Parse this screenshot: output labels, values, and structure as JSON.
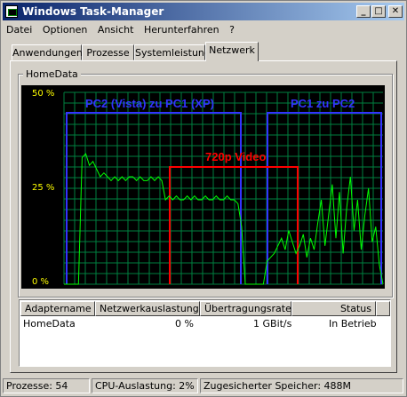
{
  "window": {
    "title": "Windows Task-Manager",
    "buttons": [
      "_",
      "□",
      "✕"
    ]
  },
  "menu": [
    {
      "label": "Datei",
      "accel": "D"
    },
    {
      "label": "Optionen",
      "accel": "O"
    },
    {
      "label": "Ansicht",
      "accel": "A"
    },
    {
      "label": "Herunterfahren",
      "accel": "H"
    },
    {
      "label": "?",
      "accel": "?"
    }
  ],
  "tabs": [
    "Anwendungen",
    "Prozesse",
    "Systemleistung",
    "Netzwerk"
  ],
  "active_tab": "Netzwerk",
  "graph": {
    "group_label": "HomeData",
    "y_ticks": [
      "50 %",
      "25 %",
      "0 %"
    ],
    "annotations": [
      "PC2 (Vista) zu PC1 (XP)",
      "PC1 zu PC2",
      "720p Video"
    ],
    "colors": {
      "grid": "#008040",
      "line": "#00ff00",
      "blue": "#3333ff",
      "red": "#ff0000",
      "axis_text": "#ffff00"
    }
  },
  "table": {
    "columns": [
      "Adaptername",
      "Netzwerkauslastung",
      "Übertragungsrate",
      "Status"
    ],
    "rows": [
      {
        "name": "HomeData",
        "usage": "0 %",
        "rate": "1 GBit/s",
        "status": "In Betrieb"
      }
    ]
  },
  "statusbar": {
    "processes": "Prozesse: 54",
    "cpu": "CPU-Auslastung: 2%",
    "memory": "Zugesicherter Speicher: 488M"
  },
  "chart_data": {
    "type": "line",
    "ylim": [
      0,
      50
    ],
    "y_tick_labels": [
      "50 %",
      "25 %",
      "0 %"
    ],
    "series": [
      {
        "values": [
          0,
          0,
          0,
          0,
          0,
          33,
          34,
          31,
          32,
          30,
          28,
          29,
          28,
          27,
          28,
          27,
          28,
          27,
          28,
          28,
          27,
          28,
          27,
          27,
          28,
          27,
          28,
          27,
          22,
          23,
          22,
          23,
          22,
          22,
          23,
          22,
          23,
          22,
          22,
          23,
          22,
          22,
          23,
          22,
          22,
          23,
          22,
          22,
          21,
          15,
          0,
          0,
          0,
          0,
          0,
          0,
          6,
          7,
          8,
          10,
          12,
          9,
          14,
          11,
          8,
          10,
          13,
          7,
          12,
          9,
          16,
          22,
          10,
          18,
          26,
          12,
          24,
          8,
          20,
          28,
          14,
          22,
          9,
          18,
          25,
          11,
          15,
          5,
          0
        ]
      }
    ]
  }
}
